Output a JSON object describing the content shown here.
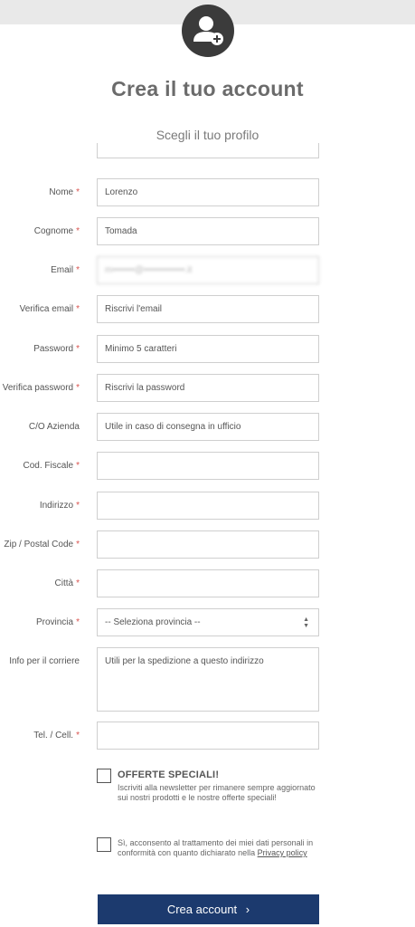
{
  "header": {
    "title": "Crea il tuo account",
    "subtitle": "Scegli il tuo profilo"
  },
  "form": {
    "required_marker": "*",
    "fields": [
      {
        "label": "Nome",
        "value": "Lorenzo",
        "required": true
      },
      {
        "label": "Cognome",
        "value": "Tomada",
        "required": true
      },
      {
        "label": "Email",
        "value": "m•••••••@•••••••••••••.it",
        "required": true
      },
      {
        "label": "Verifica email",
        "placeholder": "Riscrivi l'email",
        "required": true
      },
      {
        "label": "Password",
        "placeholder": "Minimo 5 caratteri",
        "required": true
      },
      {
        "label": "Verifica password",
        "placeholder": "Riscrivi la password",
        "required": true
      },
      {
        "label": "C/O Azienda",
        "placeholder": "Utile in caso di consegna in ufficio",
        "required": false
      },
      {
        "label": "Cod. Fiscale",
        "value": "",
        "required": true
      },
      {
        "label": "Indirizzo",
        "value": "",
        "required": true
      },
      {
        "label": "Zip / Postal Code",
        "value": "",
        "required": true
      },
      {
        "label": "Città",
        "value": "",
        "required": true
      },
      {
        "label": "Provincia",
        "selected": "-- Seleziona provincia --",
        "required": true
      },
      {
        "label": "Info per il corriere",
        "placeholder": "Utili per la spedizione a questo indirizzo",
        "required": false
      },
      {
        "label": "Tel. / Cell.",
        "value": "",
        "required": true
      }
    ]
  },
  "offers": {
    "title": "OFFERTE SPECIALI!",
    "text": "Iscriviti alla newsletter per rimanere sempre aggiornato sui nostri prodotti e le nostre offerte speciali!"
  },
  "privacy": {
    "text": "Sì, acconsento al trattamento dei miei dati personali in conformità con quanto dichiarato nella",
    "link": "Privacy policy"
  },
  "submit": {
    "label": "Crea account",
    "icon": "chevron-right-icon"
  },
  "colors": {
    "button": "#1c3a6e",
    "avatar": "#3b3b3b",
    "required": "#d9534f"
  }
}
